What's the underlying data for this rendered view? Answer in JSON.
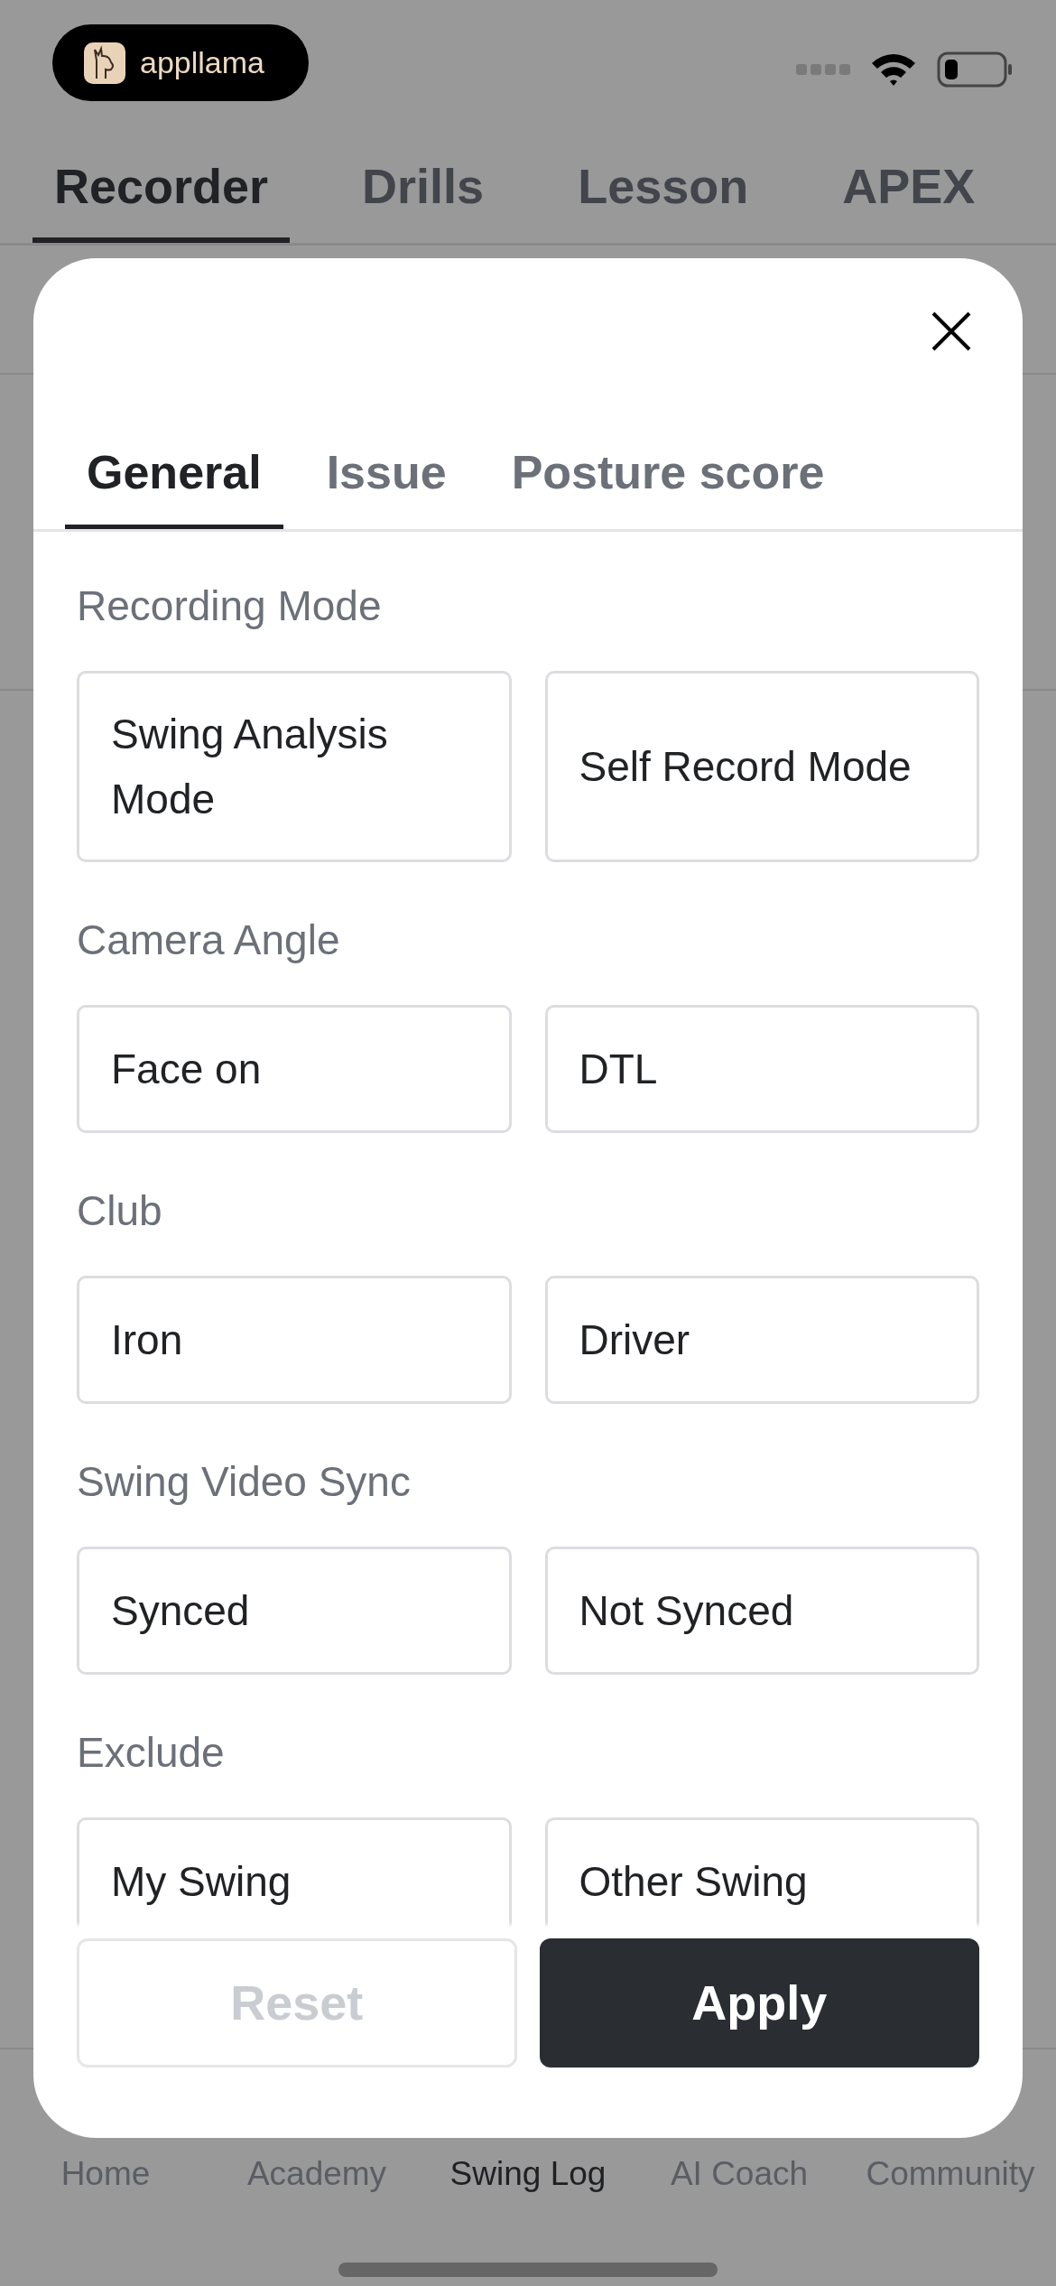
{
  "status_bar": {
    "badge": "appllama"
  },
  "top_tabs": [
    {
      "label": "Recorder",
      "selected": true
    },
    {
      "label": "Drills",
      "selected": false
    },
    {
      "label": "Lesson",
      "selected": false
    },
    {
      "label": "APEX",
      "selected": false
    }
  ],
  "filter_sheet": {
    "tabs": [
      {
        "label": "General",
        "selected": true
      },
      {
        "label": "Issue",
        "selected": false
      },
      {
        "label": "Posture score",
        "selected": false
      }
    ],
    "sections": [
      {
        "title": "Recording Mode",
        "options": [
          {
            "label": "Swing Analysis Mode",
            "selected": false
          },
          {
            "label": "Self Record Mode",
            "selected": false
          }
        ]
      },
      {
        "title": "Camera Angle",
        "options": [
          {
            "label": "Face on",
            "selected": false
          },
          {
            "label": "DTL",
            "selected": false
          }
        ]
      },
      {
        "title": "Club",
        "options": [
          {
            "label": "Iron",
            "selected": false
          },
          {
            "label": "Driver",
            "selected": false
          }
        ]
      },
      {
        "title": "Swing Video Sync",
        "options": [
          {
            "label": "Synced",
            "selected": false
          },
          {
            "label": "Not Synced",
            "selected": false
          }
        ]
      },
      {
        "title": "Exclude",
        "options": [
          {
            "label": "My Swing",
            "selected": false
          },
          {
            "label": "Other Swing",
            "selected": false
          }
        ]
      }
    ],
    "buttons": [
      {
        "label": "Reset",
        "kind": "reset",
        "disabled": true
      },
      {
        "label": "Apply",
        "kind": "apply",
        "disabled": false
      }
    ]
  },
  "bottom_nav": [
    {
      "label": "Home",
      "selected": false
    },
    {
      "label": "Academy",
      "selected": false
    },
    {
      "label": "Swing Log",
      "selected": true
    },
    {
      "label": "AI Coach",
      "selected": false
    },
    {
      "label": "Community",
      "selected": false
    }
  ]
}
